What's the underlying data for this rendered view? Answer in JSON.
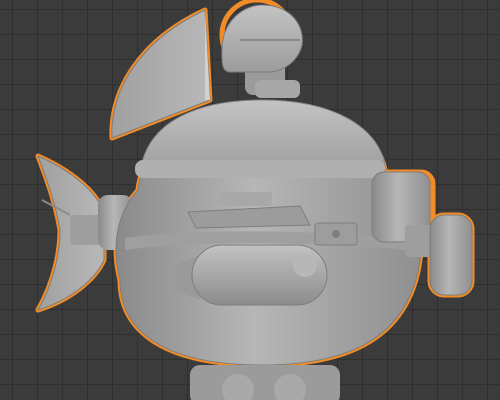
{
  "viewport": {
    "label": "3D viewport",
    "grid_color": "#2f2f2f",
    "background_color": "#3b3b3b"
  },
  "model": {
    "name": "robot-fish-submarine-with-sail-and-helmet",
    "selected": true,
    "body_color": "#a9a9a9",
    "shadow_color": "#7d7d7d",
    "highlight_color": "#c7c7c7",
    "selection_outline_color": "#f28c28"
  }
}
